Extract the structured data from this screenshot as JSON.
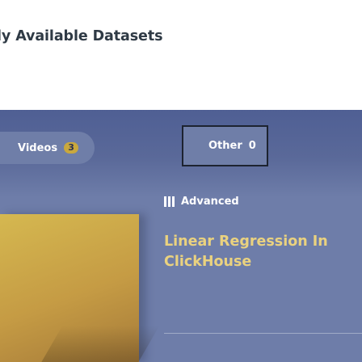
{
  "header": {
    "headline": "ly Available Datasets"
  },
  "filters": [
    {
      "label": "Videos",
      "count": "3"
    },
    {
      "label": "Other",
      "count": "0"
    }
  ],
  "course_card": {
    "level_label": "Advanced",
    "title_line1": "Linear Regression In",
    "title_line2": "ClickHouse"
  },
  "colors": {
    "section_background": "#6e7da9",
    "filter_bar_background": "#4f5f94",
    "badge_accent": "#c9a83d",
    "card_accent": "#d5b850",
    "title_highlight": "#ead27f"
  },
  "icons": {
    "level": "level-bars-icon"
  }
}
